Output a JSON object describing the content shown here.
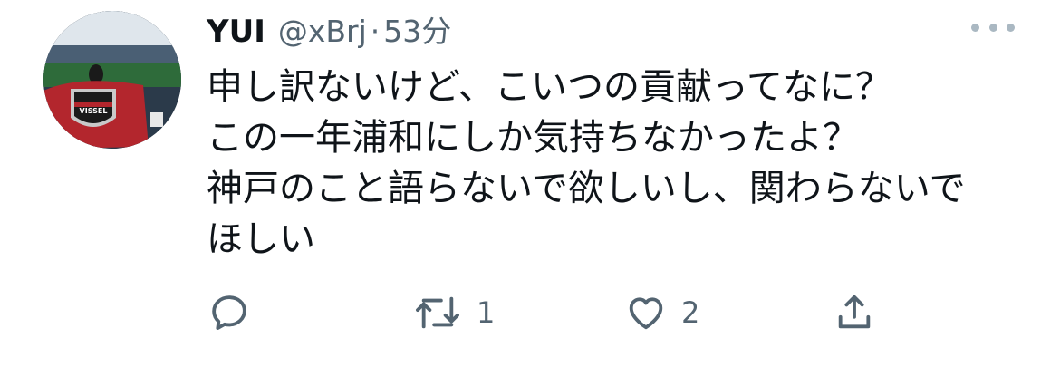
{
  "tweet": {
    "author_name": "YUI",
    "handle": "@xBrj",
    "separator": "·",
    "time": "53分",
    "avatar_banner_text": "VISSEL",
    "lines": [
      "申し訳ないけど、こいつの貢献ってなに？",
      "この一年浦和にしか気持ちなかったよ？",
      "神戸のこと語らないで欲しいし、関わらないで",
      "ほしい"
    ]
  },
  "actions": {
    "reply_icon": "reply-icon",
    "retweet_icon": "retweet-icon",
    "retweet_count": "1",
    "like_icon": "heart-icon",
    "like_count": "2",
    "share_icon": "share-icon"
  },
  "colors": {
    "text": "#0f1419",
    "secondary": "#536471",
    "more_dots": "#aab8c2",
    "avatar_flag": "#b3262d"
  }
}
